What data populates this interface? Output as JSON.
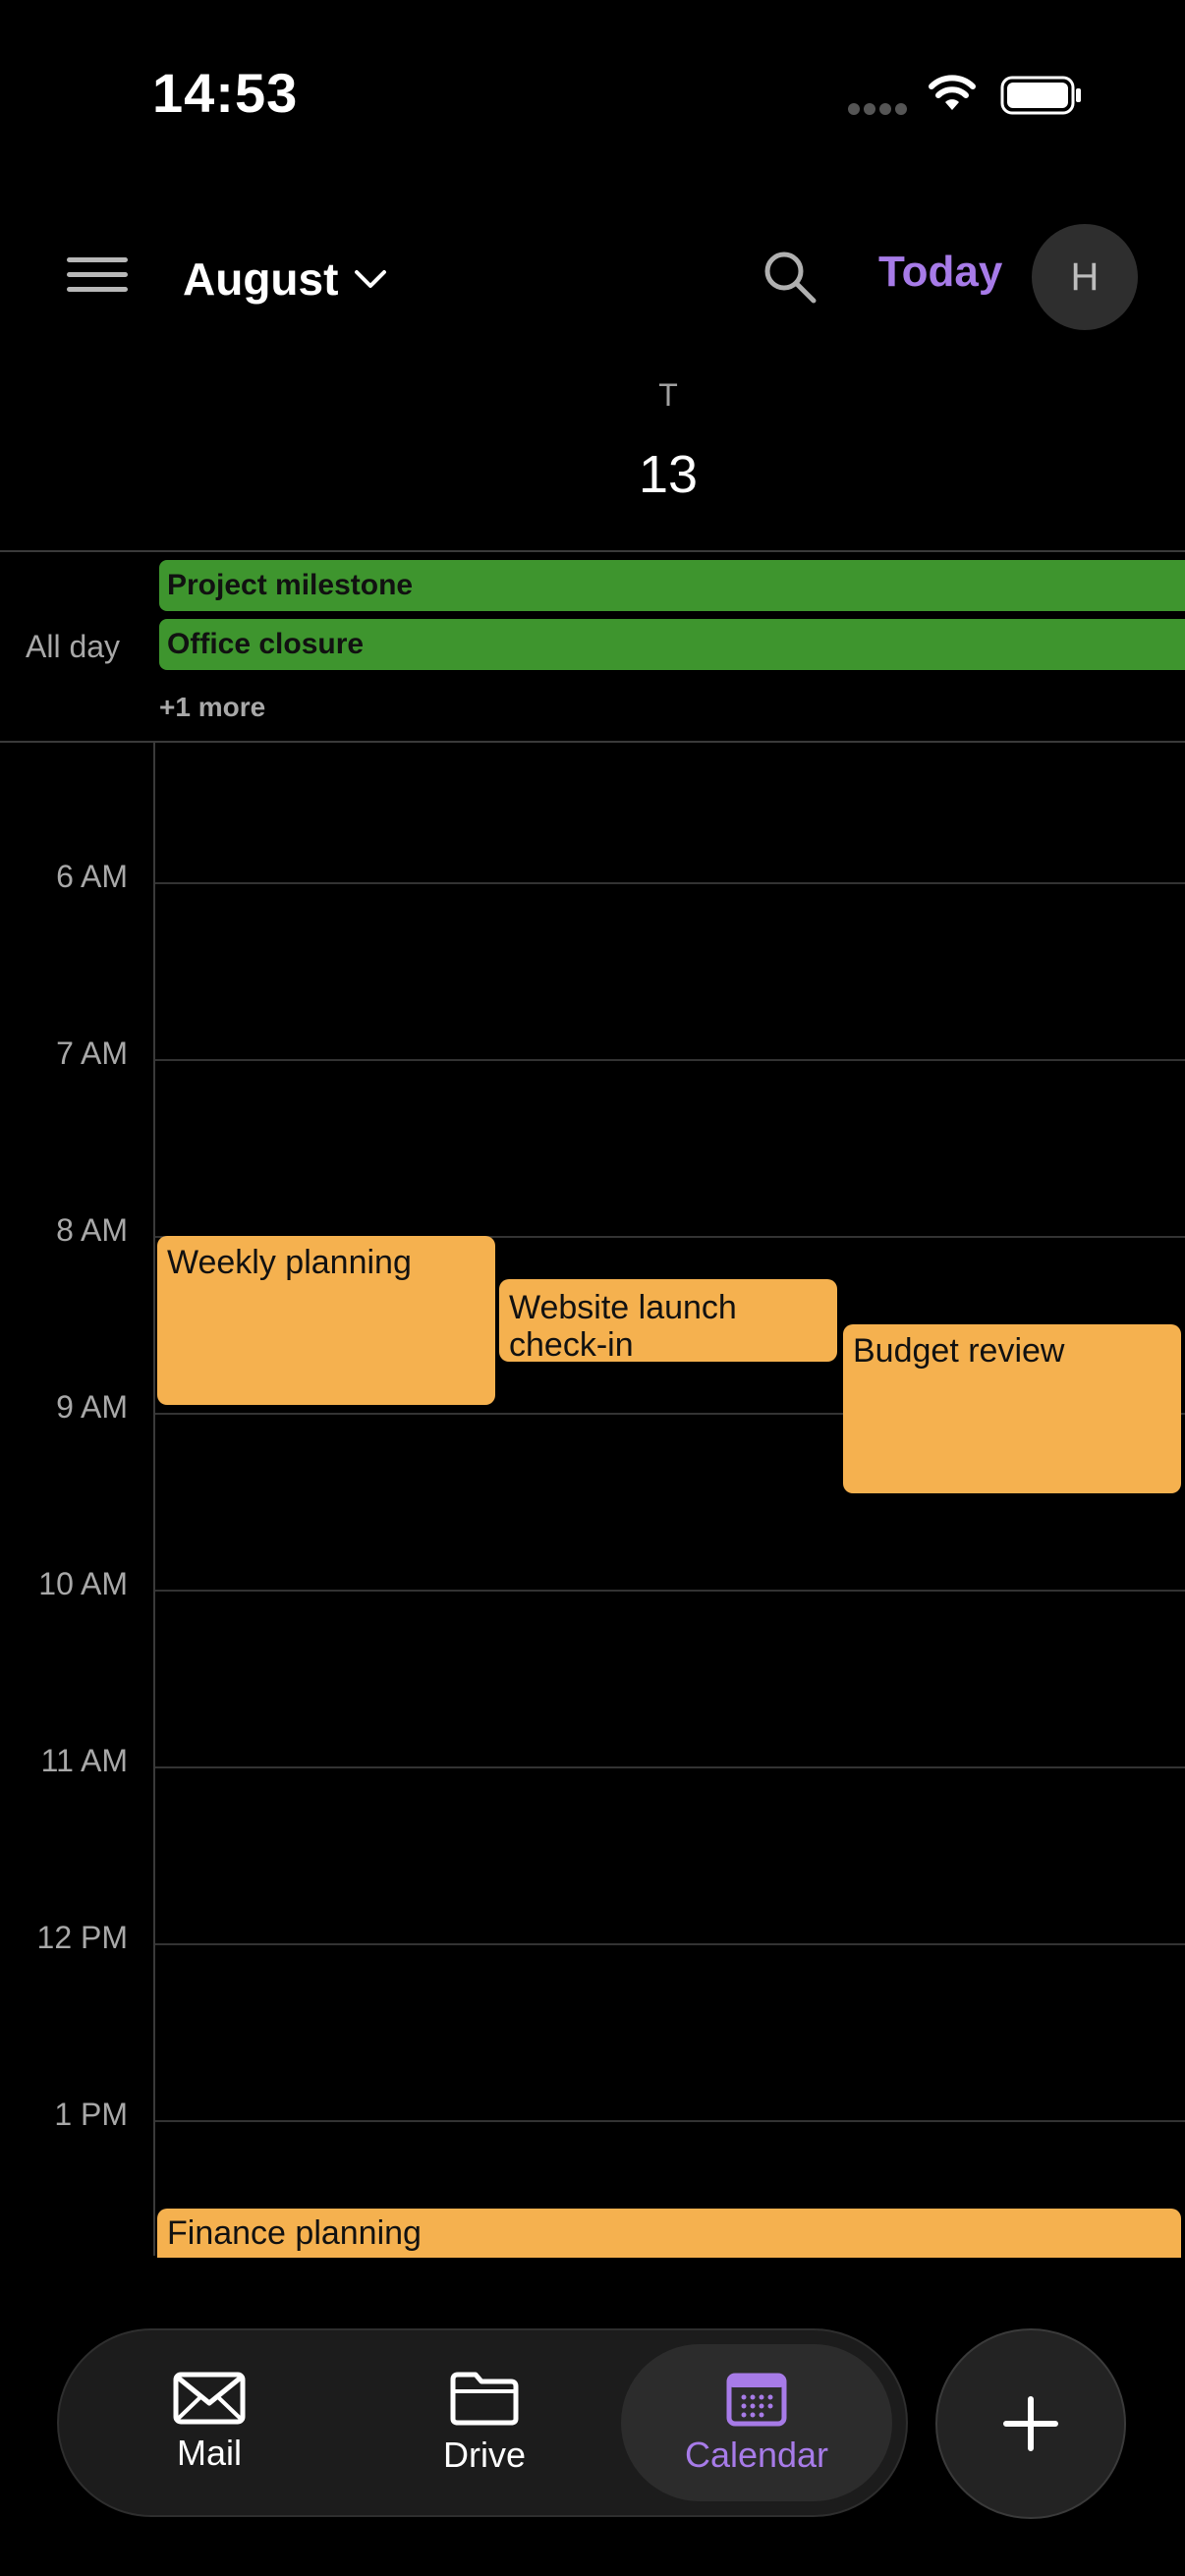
{
  "status_bar": {
    "time": "14:53"
  },
  "header": {
    "month": "August",
    "today_label": "Today",
    "avatar_initial": "H"
  },
  "day": {
    "weekday_letter": "T",
    "date": "13"
  },
  "all_day": {
    "label": "All day",
    "events": [
      "Project milestone",
      "Office closure"
    ],
    "more": "+1 more"
  },
  "hours": [
    "6 AM",
    "7 AM",
    "8 AM",
    "9 AM",
    "10 AM",
    "11 AM",
    "12 PM",
    "1 PM"
  ],
  "events": {
    "weekly_planning": "Weekly planning",
    "website_launch": "Website launch check-in",
    "budget_review": "Budget review",
    "finance_planning": "Finance planning"
  },
  "nav": {
    "mail": "Mail",
    "drive": "Drive",
    "calendar": "Calendar"
  },
  "colors": {
    "accent": "#a77be8",
    "all_day_event": "#3e952e",
    "timed_event": "#f5b14f"
  }
}
